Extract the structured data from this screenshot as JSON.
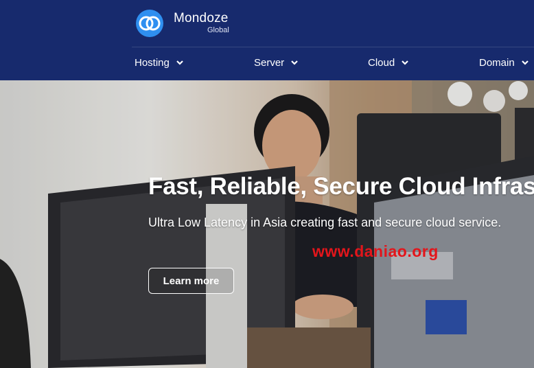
{
  "brand": {
    "name": "Mondoze",
    "subtitle": "Global"
  },
  "nav": [
    {
      "label": "Hosting"
    },
    {
      "label": "Server"
    },
    {
      "label": "Cloud"
    },
    {
      "label": "Domain"
    }
  ],
  "hero": {
    "headline": "Fast, Reliable, Secure Cloud Infrastr",
    "subline": "Ultra Low Latency in Asia  creating fast and secure cloud service.",
    "cta_label": "Learn more",
    "watermark": "www.daniao.org"
  },
  "colors": {
    "header_bg": "#172a6d",
    "logo_blue": "#2f8ff0",
    "watermark": "#e3151b"
  }
}
